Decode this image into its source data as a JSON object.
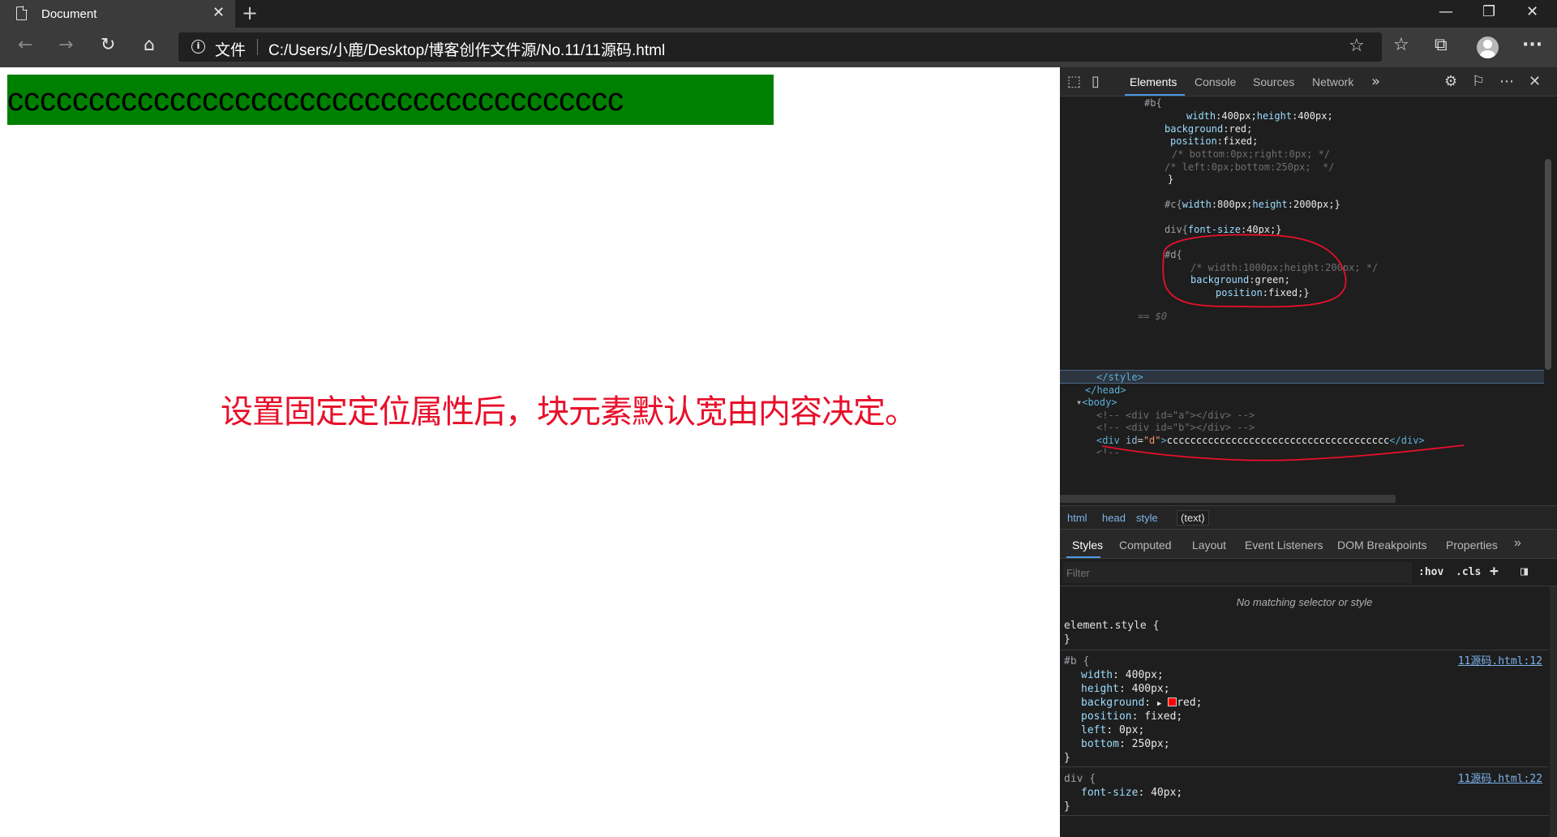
{
  "browser": {
    "tab_title": "Document",
    "address": {
      "protocol_label": "文件",
      "url": "C:/Users/小鹿/Desktop/博客创作文件源/No.11/11源码.html"
    }
  },
  "page": {
    "div_d_text": "cccccccccccccccccccccccccccccccccccccc",
    "annotation": "设置固定定位属性后，块元素默认宽由内容决定。"
  },
  "devtools": {
    "tabs": [
      "Elements",
      "Console",
      "Sources",
      "Network"
    ],
    "active_tab": "Elements",
    "code_lines": {
      "l01": "#b{",
      "l02a": "width",
      "l02b": "400px",
      "l02c": "height",
      "l02d": "400px",
      "l03a": "background",
      "l03b": "red",
      "l04a": "position",
      "l04b": "fixed",
      "l05": "/* bottom:0px;right:0px; */",
      "l06": "/* left:0px;bottom:250px;  */",
      "l07": "}",
      "l08a": "#c{",
      "l08b": "width",
      "l08c": "800px",
      "l08d": "height",
      "l08e": "2000px",
      "l08f": ";}",
      "l09a": "div{",
      "l09b": "font-size",
      "l09c": "40px",
      "l09d": ";}",
      "l10": "#d{",
      "l11": "/* width:1000px;height:200px; */",
      "l12a": "background",
      "l12b": "green",
      "l13a": "position",
      "l13b": "fixed",
      "l13c": ";}",
      "l14": "== $0",
      "l15": "</style>",
      "l16": "</head>",
      "l17": "<body>",
      "l18": "<!-- <div id=\"a\"></div> -->",
      "l19": "<!-- <div id=\"b\"></div> -->",
      "l20a": "<div",
      "l20b": "id",
      "l20c": "\"d\"",
      "l20d": ">",
      "l20e": "cccccccccccccccccccccccccccccccccccccc",
      "l20f": "</div>",
      "l21": "<!--"
    },
    "breadcrumbs": [
      "html",
      "head",
      "style",
      "(text)"
    ],
    "styles_tabs": [
      "Styles",
      "Computed",
      "Layout",
      "Event Listeners",
      "DOM Breakpoints",
      "Properties"
    ],
    "filter_placeholder": "Filter",
    "hov_label": ":hov",
    "cls_label": ".cls",
    "no_match": "No matching selector or style",
    "element_style": {
      "open": "element.style {",
      "close": "}"
    },
    "rule_b": {
      "selector": "#b {",
      "source": "11源码.html:12",
      "props": [
        {
          "name": "width",
          "value": "400px;"
        },
        {
          "name": "height",
          "value": "400px;"
        },
        {
          "name": "background",
          "value": "red;"
        },
        {
          "name": "position",
          "value": "fixed;"
        },
        {
          "name": "left",
          "value": "0px;"
        },
        {
          "name": "bottom",
          "value": "250px;"
        }
      ],
      "close": "}"
    },
    "rule_div": {
      "selector": "div {",
      "source": "11源码.html:22",
      "props": [
        {
          "name": "font-size",
          "value": "40px;"
        }
      ],
      "close": "}"
    }
  },
  "colors": {
    "div_d_background": "#008000",
    "annotation_text": "#e8102a",
    "swatch_red": "#ff0000"
  }
}
